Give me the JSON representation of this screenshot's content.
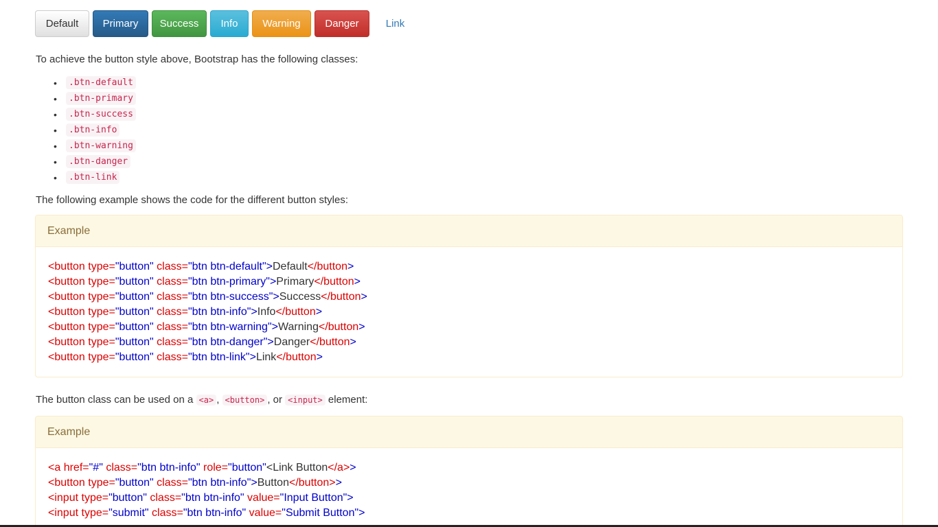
{
  "top_text_partial": "",
  "buttons": [
    {
      "label": "Default",
      "style": "default"
    },
    {
      "label": "Primary",
      "style": "primary"
    },
    {
      "label": "Success",
      "style": "success"
    },
    {
      "label": "Info",
      "style": "info"
    },
    {
      "label": "Warning",
      "style": "warning"
    },
    {
      "label": "Danger",
      "style": "danger"
    },
    {
      "label": "Link",
      "style": "link"
    }
  ],
  "intro_paragraph": "To achieve the button style above, Bootstrap has the following classes:",
  "classes": [
    ".btn-default",
    ".btn-primary",
    ".btn-success",
    ".btn-info",
    ".btn-warning",
    ".btn-danger",
    ".btn-link"
  ],
  "following_paragraph": "The following example shows the code for the different button styles:",
  "example1": {
    "heading": "Example",
    "lines": [
      {
        "tag": "button",
        "type": "button",
        "cls": "btn btn-default",
        "text": "Default"
      },
      {
        "tag": "button",
        "type": "button",
        "cls": "btn btn-primary",
        "text": "Primary"
      },
      {
        "tag": "button",
        "type": "button",
        "cls": "btn btn-success",
        "text": "Success"
      },
      {
        "tag": "button",
        "type": "button",
        "cls": "btn btn-info",
        "text": "Info"
      },
      {
        "tag": "button",
        "type": "button",
        "cls": "btn btn-warning",
        "text": "Warning"
      },
      {
        "tag": "button",
        "type": "button",
        "cls": "btn btn-danger",
        "text": "Danger"
      },
      {
        "tag": "button",
        "type": "button",
        "cls": "btn btn-link",
        "text": "Link"
      }
    ]
  },
  "button_class_paragraph": {
    "before": "The button class can be used on a ",
    "code1": "<a>",
    "sep1": ", ",
    "code2": "<button>",
    "sep2": ", or ",
    "code3": "<input>",
    "after": " element:"
  },
  "example2": {
    "heading": "Example",
    "line1": {
      "open": "<a",
      "a1": " href=",
      "v1": "\"#\"",
      "a2": " class=",
      "v2": "\"btn btn-info\"",
      "a3": " role=",
      "v3": "\"button\"",
      "text": "<Link Button",
      "close": "</a>"
    },
    "line2": {
      "open": "<button",
      "a1": " type=",
      "v1": "\"button\"",
      "a2": " class=",
      "v2": "\"btn btn-info\"",
      "text": "Button",
      "close": "</button>"
    },
    "line3": {
      "open": "<input",
      "a1": " type=",
      "v1": "\"button\"",
      "a2": " class=",
      "v2": "\"btn btn-info\"",
      "a3": " value=",
      "v3": "\"Input Button\""
    },
    "line4": {
      "open": "<input",
      "a1": " type=",
      "v1": "\"submit\"",
      "a2": " class=",
      "v2": "\"btn btn-info\"",
      "a3": " value=",
      "v3": "\"Submit Button\""
    }
  },
  "colors": {
    "default": "#e0e0e0",
    "primary": "#337ab7",
    "success": "#5cb85c",
    "info": "#5bc0de",
    "warning": "#f0ad4e",
    "danger": "#d9534f",
    "link": "#337ab7",
    "code_tag": "#dd0000",
    "code_value": "#0000cd",
    "example_heading_bg": "#fcf8e3"
  }
}
